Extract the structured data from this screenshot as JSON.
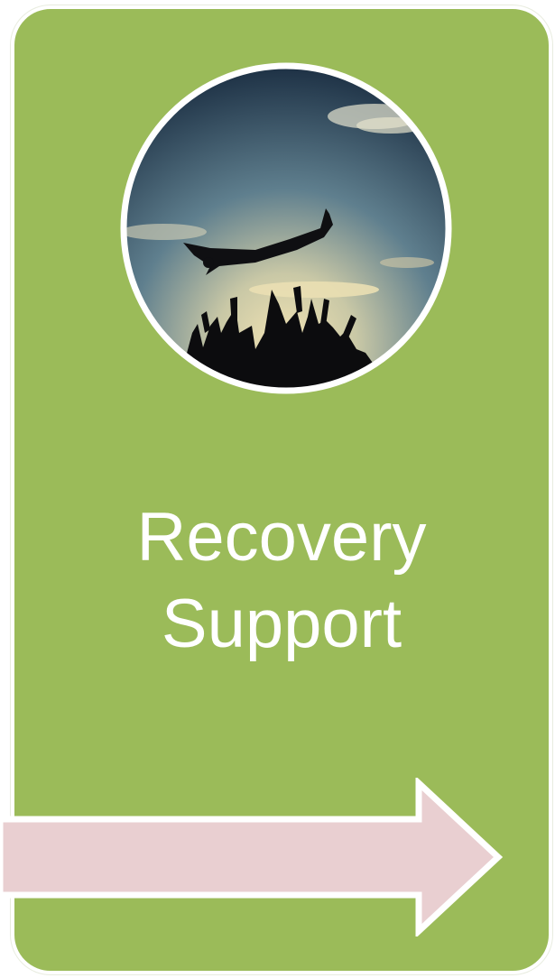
{
  "title": {
    "line1": "Recovery",
    "line2": "Support"
  },
  "colors": {
    "card": "#9bbb59",
    "card_border": "#ffffff",
    "arrow_fill": "#e9cfd1",
    "arrow_outline": "#ffffff",
    "text": "#ffffff"
  },
  "image": {
    "icon": "crowd-surfing-photo"
  },
  "arrow": {
    "icon": "right-arrow-icon",
    "direction": "right"
  }
}
